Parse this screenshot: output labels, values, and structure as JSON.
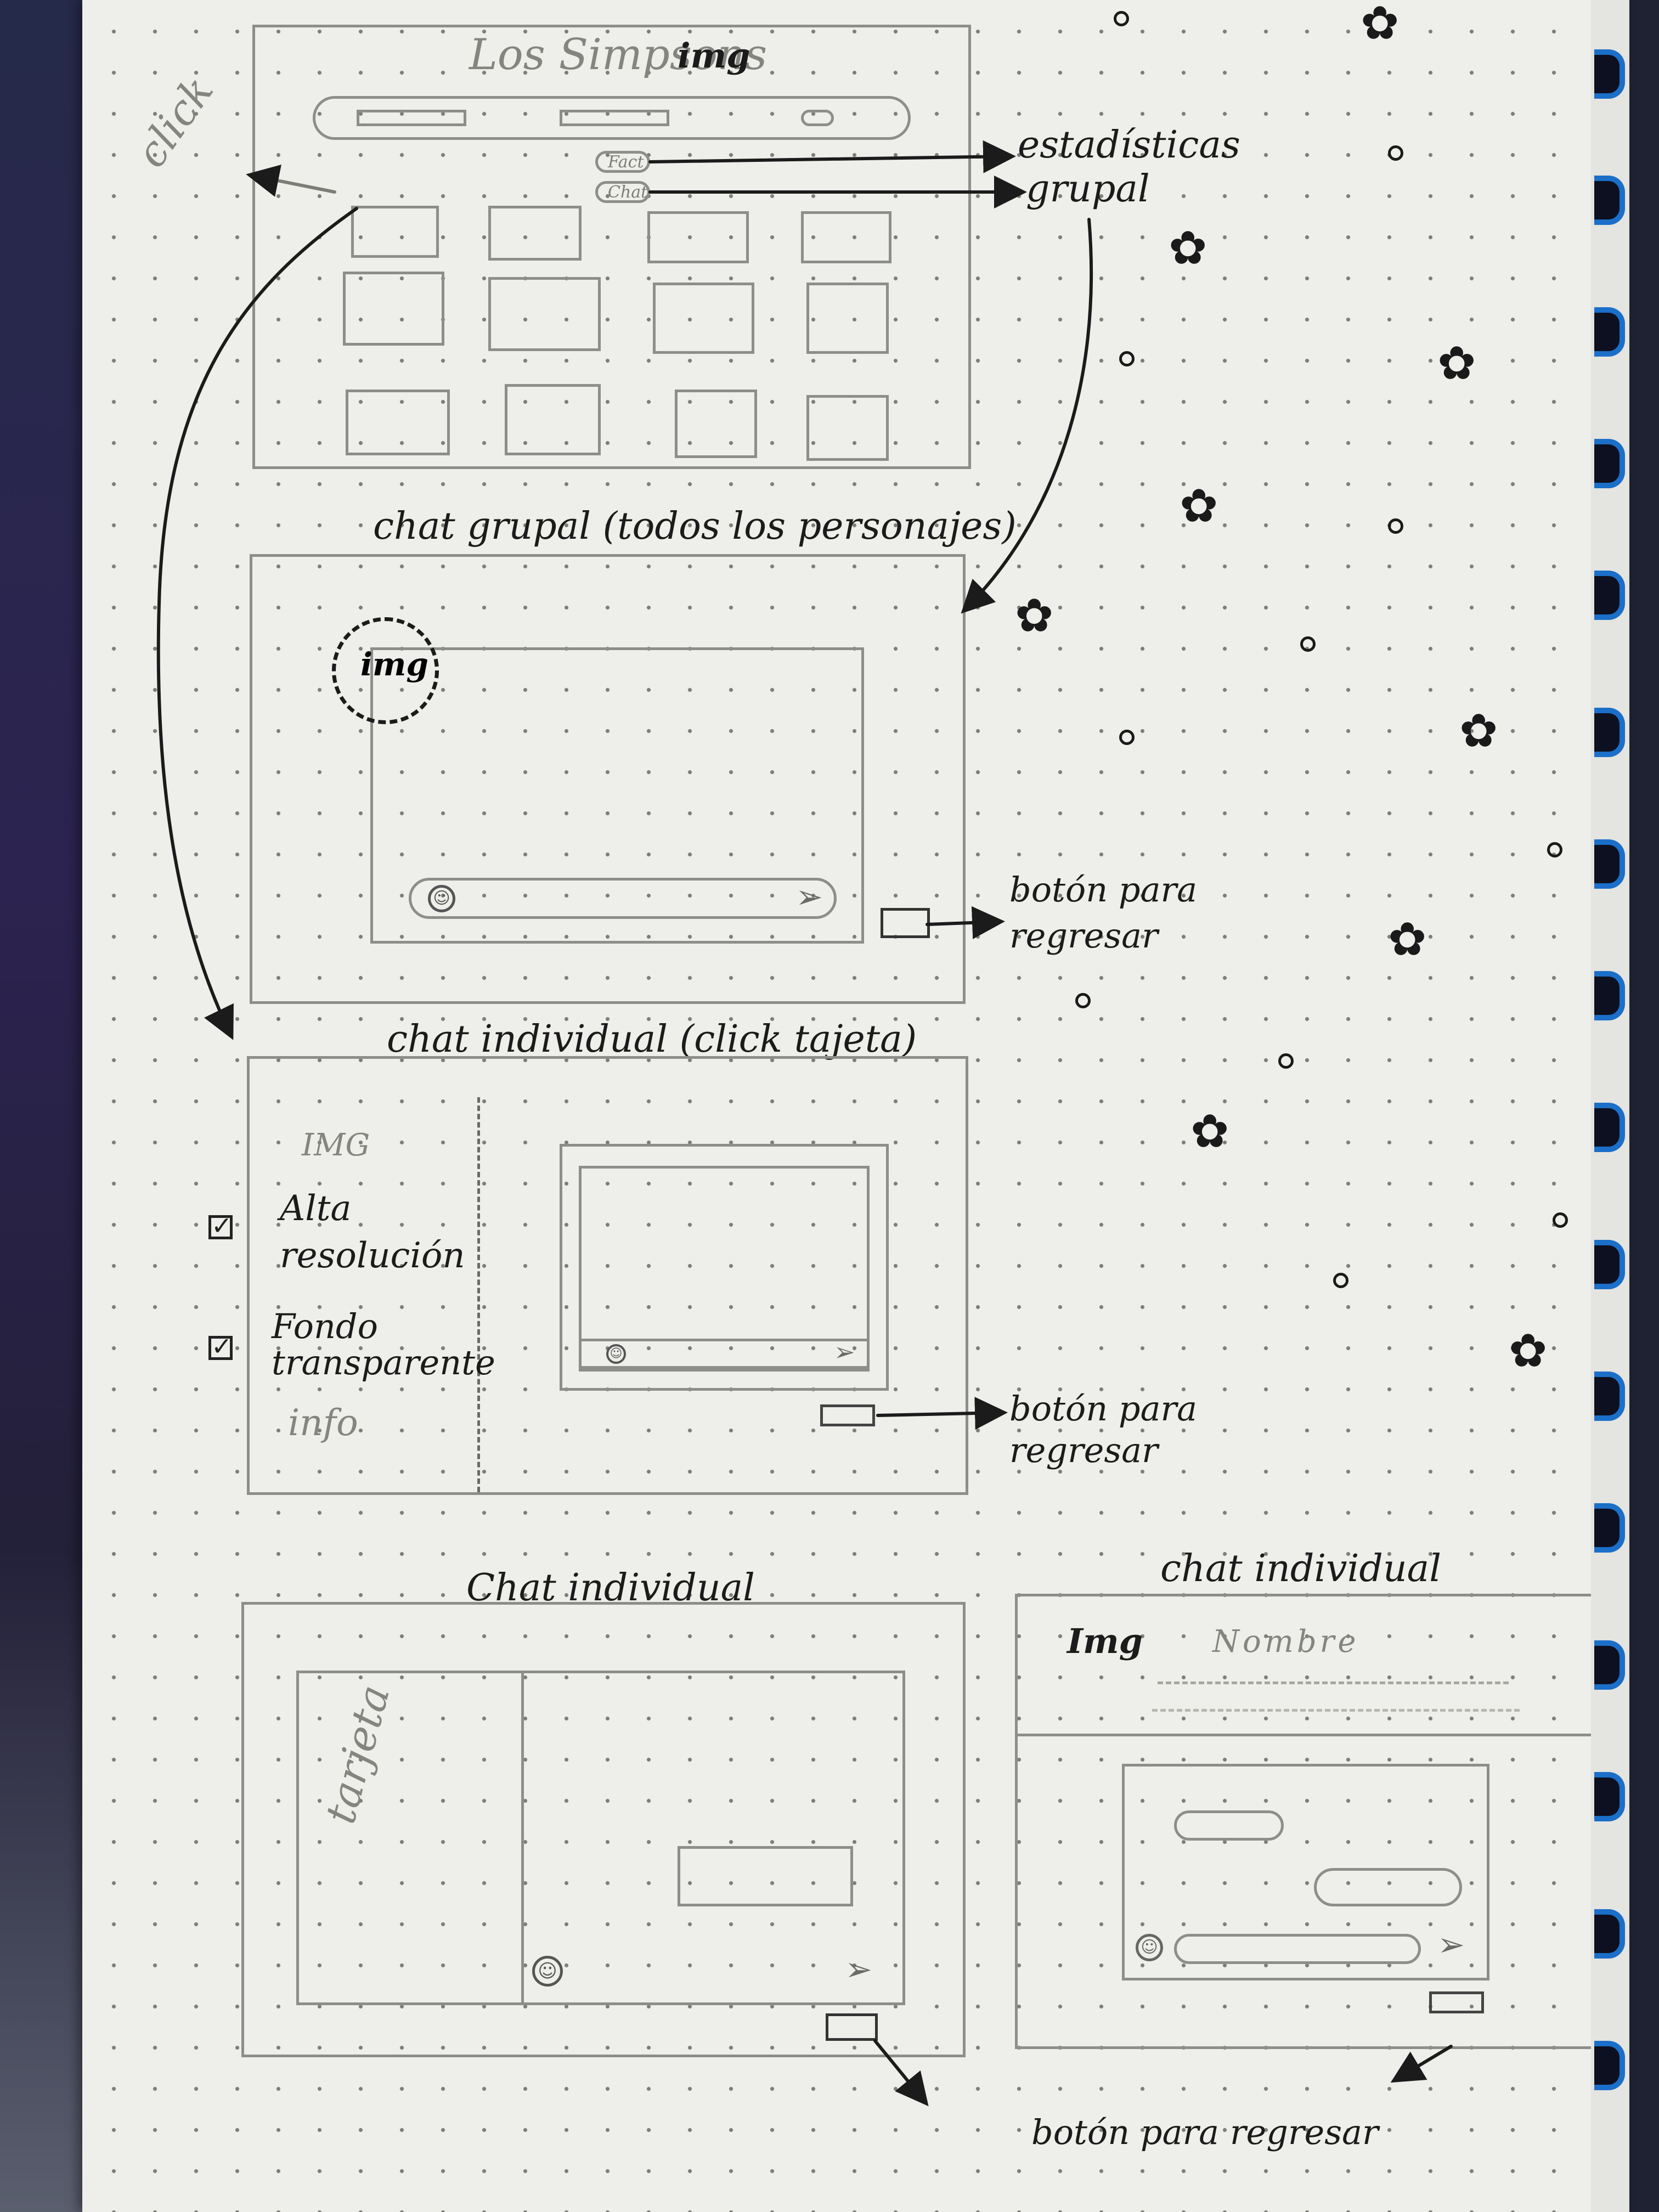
{
  "main_screen": {
    "title": "Los Simpsons",
    "title_img": "img",
    "fact_tag": "Fact",
    "chat_tag": "Chat",
    "click_label": "click",
    "estadisticas_label": "estadísticas",
    "grupal_label": "grupal"
  },
  "group_chat": {
    "heading": "chat grupal (todos los personajes)",
    "avatar_label": "img",
    "back_label": "botón para regresar"
  },
  "individual_chat_card": {
    "heading": "chat individual (click tajeta)",
    "img_label": "IMG",
    "option_high_res": "Alta resolución",
    "option_transparent": "Fondo transparente",
    "info_label": "info",
    "back_label": "botón para regresar"
  },
  "individual_chat_a": {
    "heading": "Chat individual",
    "card_label": "tarjeta"
  },
  "individual_chat_b": {
    "heading": "chat individual",
    "img_label": "Img",
    "name_label": "Nombre"
  },
  "footer": {
    "back_label": "botón para regresar"
  },
  "icons": {
    "emoji": "smiley-icon",
    "send": "send-arrow-icon",
    "decoration": "flower-doodle-icon"
  },
  "colors": {
    "ink": "#1b1b1b",
    "pencil": "#8d8d89",
    "paper": "#eeeeea",
    "ring": "#1b6fc8"
  }
}
